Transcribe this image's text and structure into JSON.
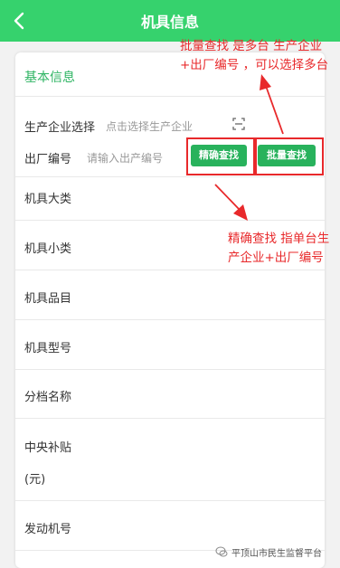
{
  "header": {
    "title": "机具信息",
    "back_icon": "chevron-left-icon",
    "background": "#36d26d"
  },
  "section": {
    "title": "基本信息"
  },
  "form": {
    "manufacturer_label": "生产企业选择",
    "manufacturer_placeholder": "点击选择生产企业",
    "serial_label": "出厂编号",
    "serial_placeholder": "请输入出产编号",
    "exact_search_label": "精确查找",
    "batch_search_label": "批量查找",
    "fields": [
      "机具大类",
      "机具小类",
      "机具品目",
      "机具型号",
      "分档名称",
      "中央补贴",
      "(元)",
      "发动机号"
    ]
  },
  "annotations": {
    "batch": "批量查找 是多台 生产企业 +出厂编号 ，可以选择多台",
    "exact": "精确查找 指单台生产企业+出厂编号",
    "color": "#e8292b"
  },
  "watermark": {
    "text": "平顶山市民生监督平台"
  }
}
